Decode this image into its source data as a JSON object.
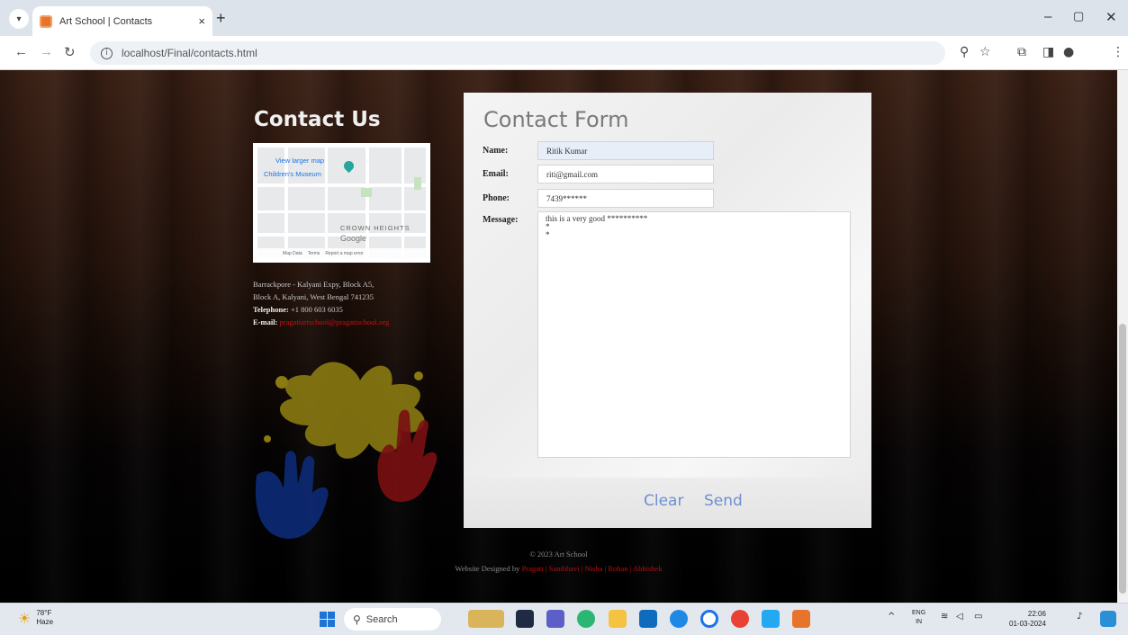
{
  "browser": {
    "tab_title": "Art School | Contacts",
    "tab_close": "×",
    "new_tab": "+",
    "url": "localhost/Final/contacts.html",
    "icons": [
      "tab-list-icon",
      "back-icon",
      "forward-icon",
      "reload-icon",
      "site-info-icon",
      "zoom-icon",
      "bookmark-star-icon",
      "extensions-icon",
      "side-panel-icon",
      "profile-icon",
      "menu-icon",
      "minimize-icon",
      "restore-icon",
      "close-window-icon"
    ]
  },
  "contact": {
    "title": "Contact Us",
    "map": {
      "link": "View larger map",
      "museum": "Children's Museum",
      "area": "CROWN HEIGHTS",
      "brand": "Google",
      "footer": [
        "Map Data",
        "Terms",
        "Report a map error"
      ]
    },
    "address_line1": "Barrackpore - Kalyani Expy, Block A5,",
    "address_line2": "Block A, Kalyani, West Bengal 741235",
    "telephone_label": "Telephone:",
    "telephone_value": "+1 800 603 6035",
    "email_label": "E-mail:",
    "email_value": "pragatiartschool@pragatischool.org"
  },
  "form": {
    "title": "Contact Form",
    "name_label": "Name:",
    "name_value": "Ritik Kumar",
    "email_label": "Email:",
    "email_value": "riti@gmail.com",
    "phone_label": "Phone:",
    "phone_value": "7439******",
    "message_label": "Message:",
    "message_value": "this is a very good **********\n*\n*",
    "clear_label": "Clear",
    "send_label": "Send"
  },
  "footer": {
    "copyright": "© 2023 Art School",
    "designed_by": "Website Designed by",
    "designers": "Pragati | Sambhavi | Nisha | Rohan | Abhishek"
  },
  "taskbar": {
    "temp": "78°F",
    "condition": "Haze",
    "search_label": "Search",
    "lang_top": "ENG",
    "lang_bottom": "IN",
    "time": "22:06",
    "date": "01-03-2024"
  },
  "colors": {
    "accent_link": "#c51212",
    "button_text": "#6f8fd2",
    "taskbar_bg": "#e3e8ef"
  }
}
